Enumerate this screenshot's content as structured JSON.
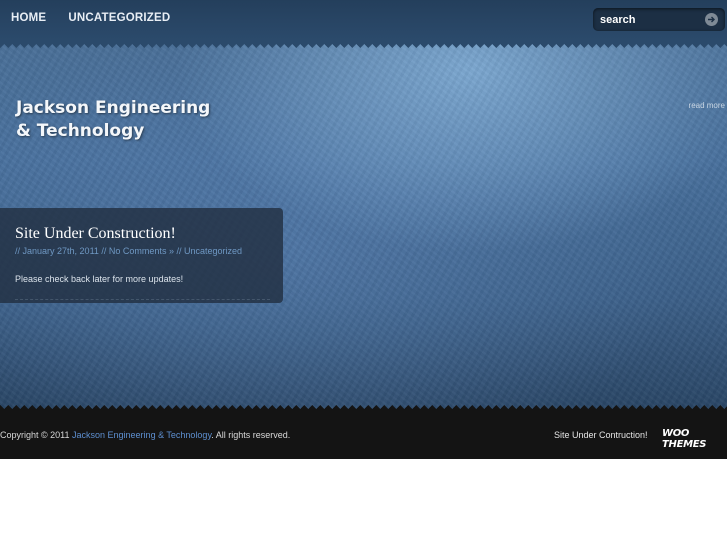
{
  "nav": {
    "items": [
      {
        "label": "HOME"
      },
      {
        "label": "UNCATEGORIZED"
      }
    ]
  },
  "search": {
    "placeholder": "search",
    "button_icon": "arrow-right-icon"
  },
  "site": {
    "title_line1": "Jackson Engineering",
    "title_line2": "& Technology"
  },
  "featured": {
    "read_more": "read more"
  },
  "post": {
    "title": "Site Under Construction!",
    "meta_prefix": "// ",
    "date": "January 27th, 2011",
    "meta_sep1": " // ",
    "comments": "No Comments »",
    "meta_sep2": " // ",
    "category": "Uncategorized",
    "excerpt": "Please check back later for more updates!"
  },
  "footer": {
    "copyright_prefix": "Copyright © 2011 ",
    "site_link": "Jackson Engineering & Technology",
    "copyright_suffix": ". All rights reserved.",
    "tagline": "Site Under Contruction!",
    "credit_logo": "WOO THEMES"
  },
  "colors": {
    "background_blue": "#48709d",
    "link_blue": "#5d8fd0",
    "meta_blue": "#6f98c3",
    "footer_bg": "#141414"
  }
}
